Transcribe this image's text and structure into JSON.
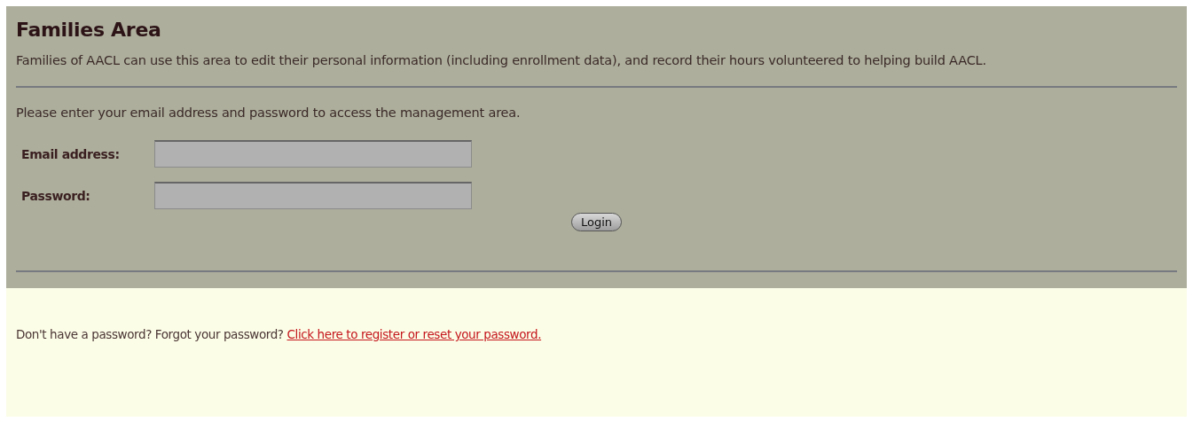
{
  "title": "Families Area",
  "intro": "Families of AACL can use this area to edit their personal information (including enrollment data), and record their hours volunteered to helping build AACL.",
  "instruction": "Please enter your email address and password to access the management area.",
  "fields": [
    {
      "label": "Email address:"
    },
    {
      "label": "Password:"
    }
  ],
  "login_button": "Login",
  "footer": {
    "text": "Don't have a password? Forgot your password?",
    "link": "Click here to register or reset your password."
  }
}
